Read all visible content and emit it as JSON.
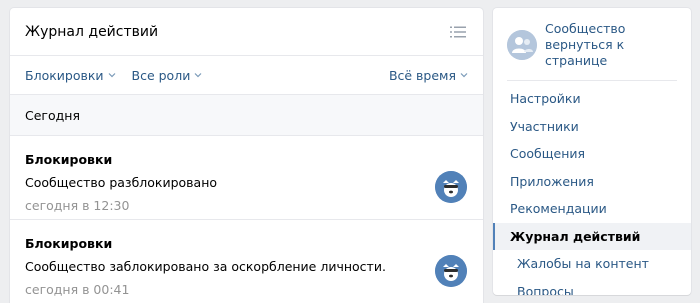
{
  "main": {
    "title": "Журнал действий",
    "header_icon": "list-icon",
    "filters": {
      "type": "Блокировки",
      "roles": "Все роли",
      "period": "Всё время"
    },
    "date_label": "Сегодня",
    "entries": [
      {
        "type": "Блокировки",
        "text": "Сообщество разблокировано",
        "time": "сегодня в 12:30",
        "avatar_icon": "vk-dog-avatar"
      },
      {
        "type": "Блокировки",
        "text": "Сообщество заблокировано за оскорбление личности.",
        "time": "сегодня в 00:41",
        "avatar_icon": "vk-dog-avatar"
      }
    ]
  },
  "sidebar": {
    "group_name": "Сообщество",
    "group_sub": "вернуться к странице",
    "items": [
      {
        "label": "Настройки"
      },
      {
        "label": "Участники"
      },
      {
        "label": "Сообщения"
      },
      {
        "label": "Приложения"
      },
      {
        "label": "Рекомендации"
      },
      {
        "label": "Журнал действий"
      },
      {
        "label": "Жалобы на контент"
      },
      {
        "label": "Вопросы"
      }
    ],
    "active_item": "Журнал действий"
  },
  "colors": {
    "link": "#2a5885",
    "accent": "#5181b8",
    "background": "#edeef0",
    "muted": "#939393"
  }
}
